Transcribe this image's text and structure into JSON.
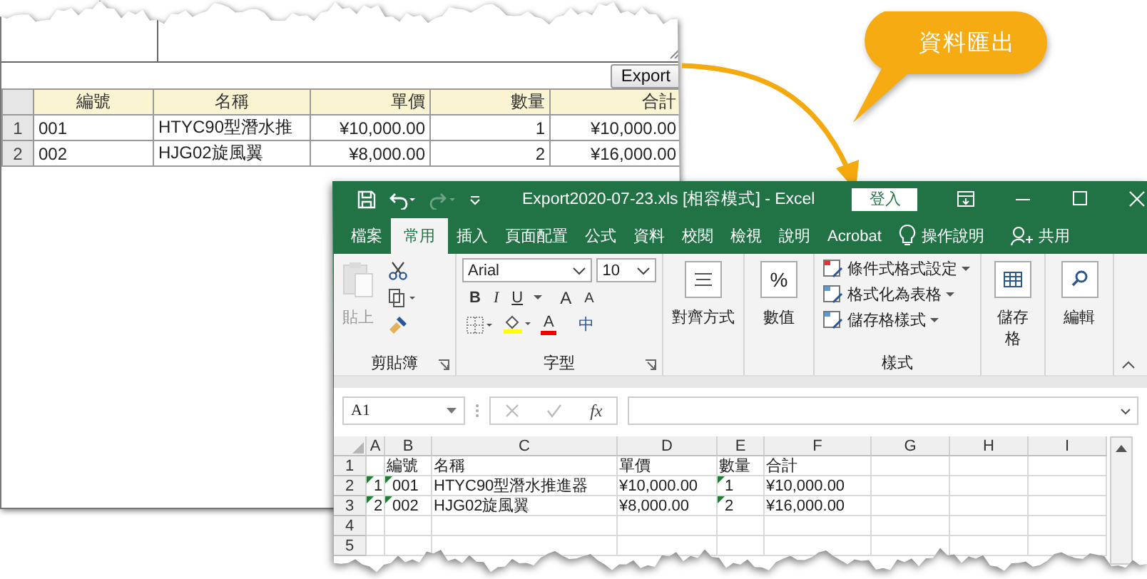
{
  "web_page": {
    "export_button": "Export",
    "table": {
      "columns": [
        "編號",
        "名稱",
        "單價",
        "數量",
        "合計"
      ],
      "rows": [
        {
          "index": "1",
          "cells": [
            "001",
            "HTYC90型潛水推",
            "¥10,000.00",
            "1",
            "¥10,000.00"
          ]
        },
        {
          "index": "2",
          "cells": [
            "002",
            "HJG02旋風翼",
            "¥8,000.00",
            "2",
            "¥16,000.00"
          ]
        }
      ]
    }
  },
  "callout": "資料匯出",
  "excel": {
    "title": "Export2020-07-23.xls  [相容模式]  -  Excel",
    "sign_in": "登入",
    "tabs": [
      {
        "label": "檔案",
        "selected": false
      },
      {
        "label": "常用",
        "selected": true
      },
      {
        "label": "插入",
        "selected": false
      },
      {
        "label": "頁面配置",
        "selected": false
      },
      {
        "label": "公式",
        "selected": false
      },
      {
        "label": "資料",
        "selected": false
      },
      {
        "label": "校閱",
        "selected": false
      },
      {
        "label": "檢視",
        "selected": false
      },
      {
        "label": "說明",
        "selected": false
      },
      {
        "label": "Acrobat",
        "selected": false
      }
    ],
    "tell_me": "操作說明",
    "share": "共用",
    "ribbon": {
      "clipboard": {
        "paste": {
          "label": "貼上",
          "disabled": true
        },
        "label": "剪貼簿"
      },
      "font": {
        "name": "Arial",
        "size": "10",
        "styles": [
          "B",
          "I",
          "U"
        ],
        "grow": "A",
        "shrink": "A",
        "color_button": "A",
        "phonetic": "中",
        "label": "字型"
      },
      "alignment": "對齊方式",
      "number": {
        "symbol": "%",
        "label": "數值"
      },
      "styles": {
        "items": [
          "條件式格式設定",
          "格式化為表格",
          "儲存格樣式"
        ],
        "label": "樣式"
      },
      "cells": "儲存格",
      "editing": "編輯"
    },
    "name_box": "A1",
    "function_label": "fx",
    "columns": [
      "A",
      "B",
      "C",
      "D",
      "E",
      "F",
      "G",
      "H",
      "I"
    ],
    "rows": [
      {
        "header": "1",
        "cells": [
          null,
          {
            "text": "編號",
            "flagged": false
          },
          {
            "text": "名稱",
            "flagged": false
          },
          {
            "text": "單價",
            "flagged": false
          },
          {
            "text": "數量",
            "flagged": false
          },
          {
            "text": "合計",
            "flagged": false
          }
        ]
      },
      {
        "header": "2",
        "cells": [
          {
            "text": "1",
            "flagged": true
          },
          {
            "text": "001",
            "flagged": true
          },
          {
            "text": "HTYC90型潛水推進器",
            "flagged": false
          },
          {
            "text": "¥10,000.00",
            "flagged": false
          },
          {
            "text": "1",
            "flagged": true
          },
          {
            "text": "¥10,000.00",
            "flagged": false
          }
        ]
      },
      {
        "header": "3",
        "cells": [
          {
            "text": "2",
            "flagged": true
          },
          {
            "text": "002",
            "flagged": true
          },
          {
            "text": "HJG02旋風翼",
            "flagged": false
          },
          {
            "text": "¥8,000.00",
            "flagged": false
          },
          {
            "text": "2",
            "flagged": true
          },
          {
            "text": "¥16,000.00",
            "flagged": false
          }
        ]
      },
      {
        "header": "4"
      },
      {
        "header": "5"
      }
    ]
  }
}
